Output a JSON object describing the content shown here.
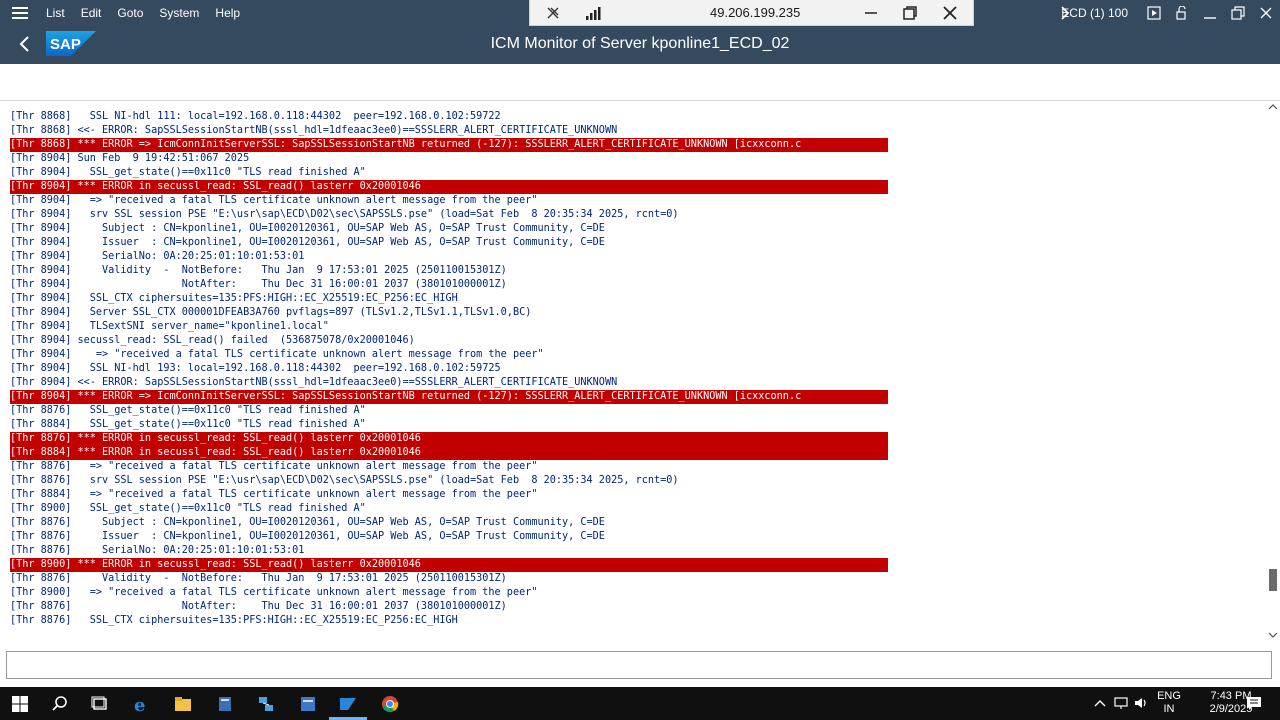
{
  "menu": {
    "items": [
      "List",
      "Edit",
      "Goto",
      "System",
      "Help"
    ]
  },
  "header": {
    "title": "ICM Monitor of Server kponline1_ECD_02",
    "system": "ECD (1) 100"
  },
  "rdp": {
    "ip": "49.206.199.235"
  },
  "log": {
    "lines": [
      {
        "text": "[Thr 8868]   SSL NI-hdl 111: local=192.168.0.118:44302  peer=192.168.0.102:59722",
        "error": false
      },
      {
        "text": "[Thr 8868] <<- ERROR: SapSSLSessionStartNB(sssl_hdl=1dfeaac3ee0)==SSSLERR_ALERT_CERTIFICATE_UNKNOWN",
        "error": false
      },
      {
        "text": "[Thr 8868] *** ERROR => IcmConnInitServerSSL: SapSSLSessionStartNB returned (-127): SSSLERR_ALERT_CERTIFICATE_UNKNOWN [icxxconn.c",
        "error": true
      },
      {
        "text": "[Thr 8904] Sun Feb  9 19:42:51:067 2025",
        "error": false
      },
      {
        "text": "[Thr 8904]   SSL_get_state()==0x11c0 \"TLS read finished A\"",
        "error": false
      },
      {
        "text": "[Thr 8904] *** ERROR in secussl_read: SSL_read() lasterr 0x20001046",
        "error": true
      },
      {
        "text": "[Thr 8904]   => \"received a fatal TLS certificate unknown alert message from the peer\"",
        "error": false
      },
      {
        "text": "[Thr 8904]   srv SSL session PSE \"E:\\usr\\sap\\ECD\\D02\\sec\\SAPSSLS.pse\" (load=Sat Feb  8 20:35:34 2025, rcnt=0)",
        "error": false
      },
      {
        "text": "[Thr 8904]     Subject : CN=kponline1, OU=I0020120361, OU=SAP Web AS, O=SAP Trust Community, C=DE",
        "error": false
      },
      {
        "text": "[Thr 8904]     Issuer  : CN=kponline1, OU=I0020120361, OU=SAP Web AS, O=SAP Trust Community, C=DE",
        "error": false
      },
      {
        "text": "[Thr 8904]     SerialNo: 0A:20:25:01:10:01:53:01",
        "error": false
      },
      {
        "text": "[Thr 8904]     Validity  -  NotBefore:   Thu Jan  9 17:53:01 2025 (250110015301Z)",
        "error": false
      },
      {
        "text": "[Thr 8904]                  NotAfter:    Thu Dec 31 16:00:01 2037 (380101000001Z)",
        "error": false
      },
      {
        "text": "[Thr 8904]   SSL_CTX ciphersuites=135:PFS:HIGH::EC_X25519:EC_P256:EC_HIGH",
        "error": false
      },
      {
        "text": "[Thr 8904]   Server SSL_CTX 000001DFEAB3A760 pvflags=897 (TLSv1.2,TLSv1.1,TLSv1.0,BC)",
        "error": false
      },
      {
        "text": "[Thr 8904]   TLSextSNI server_name=\"kponline1.local\"",
        "error": false
      },
      {
        "text": "[Thr 8904] secussl_read: SSL_read() failed  (536875078/0x20001046)",
        "error": false
      },
      {
        "text": "[Thr 8904]    => \"received a fatal TLS certificate unknown alert message from the peer\"",
        "error": false
      },
      {
        "text": "[Thr 8904]   SSL NI-hdl 193: local=192.168.0.118:44302  peer=192.168.0.102:59725",
        "error": false
      },
      {
        "text": "[Thr 8904] <<- ERROR: SapSSLSessionStartNB(sssl_hdl=1dfeaac3ee0)==SSSLERR_ALERT_CERTIFICATE_UNKNOWN",
        "error": false
      },
      {
        "text": "[Thr 8904] *** ERROR => IcmConnInitServerSSL: SapSSLSessionStartNB returned (-127): SSSLERR_ALERT_CERTIFICATE_UNKNOWN [icxxconn.c",
        "error": true
      },
      {
        "text": "[Thr 8876]   SSL_get_state()==0x11c0 \"TLS read finished A\"",
        "error": false
      },
      {
        "text": "[Thr 8884]   SSL_get_state()==0x11c0 \"TLS read finished A\"",
        "error": false
      },
      {
        "text": "[Thr 8876] *** ERROR in secussl_read: SSL_read() lasterr 0x20001046",
        "error": true
      },
      {
        "text": "[Thr 8884] *** ERROR in secussl_read: SSL_read() lasterr 0x20001046",
        "error": true
      },
      {
        "text": "[Thr 8876]   => \"received a fatal TLS certificate unknown alert message from the peer\"",
        "error": false
      },
      {
        "text": "[Thr 8876]   srv SSL session PSE \"E:\\usr\\sap\\ECD\\D02\\sec\\SAPSSLS.pse\" (load=Sat Feb  8 20:35:34 2025, rcnt=0)",
        "error": false
      },
      {
        "text": "[Thr 8884]   => \"received a fatal TLS certificate unknown alert message from the peer\"",
        "error": false
      },
      {
        "text": "[Thr 8900]   SSL_get_state()==0x11c0 \"TLS read finished A\"",
        "error": false
      },
      {
        "text": "[Thr 8876]     Subject : CN=kponline1, OU=I0020120361, OU=SAP Web AS, O=SAP Trust Community, C=DE",
        "error": false
      },
      {
        "text": "[Thr 8876]     Issuer  : CN=kponline1, OU=I0020120361, OU=SAP Web AS, O=SAP Trust Community, C=DE",
        "error": false
      },
      {
        "text": "[Thr 8876]     SerialNo: 0A:20:25:01:10:01:53:01",
        "error": false
      },
      {
        "text": "[Thr 8900] *** ERROR in secussl_read: SSL_read() lasterr 0x20001046",
        "error": true
      },
      {
        "text": "[Thr 8876]     Validity  -  NotBefore:   Thu Jan  9 17:53:01 2025 (250110015301Z)",
        "error": false
      },
      {
        "text": "[Thr 8900]   => \"received a fatal TLS certificate unknown alert message from the peer\"",
        "error": false
      },
      {
        "text": "[Thr 8876]                  NotAfter:    Thu Dec 31 16:00:01 2037 (380101000001Z)",
        "error": false
      },
      {
        "text": "[Thr 8876]   SSL_CTX ciphersuites=135:PFS:HIGH::EC_X25519:EC_P256:EC_HIGH",
        "error": false
      }
    ]
  },
  "taskbar": {
    "lang": "ENG",
    "region": "IN",
    "time": "7:43 PM",
    "date": "2/9/2025"
  },
  "colors": {
    "shell": "#354a5f",
    "error_bg": "#c30000",
    "log_text": "#00257a"
  }
}
